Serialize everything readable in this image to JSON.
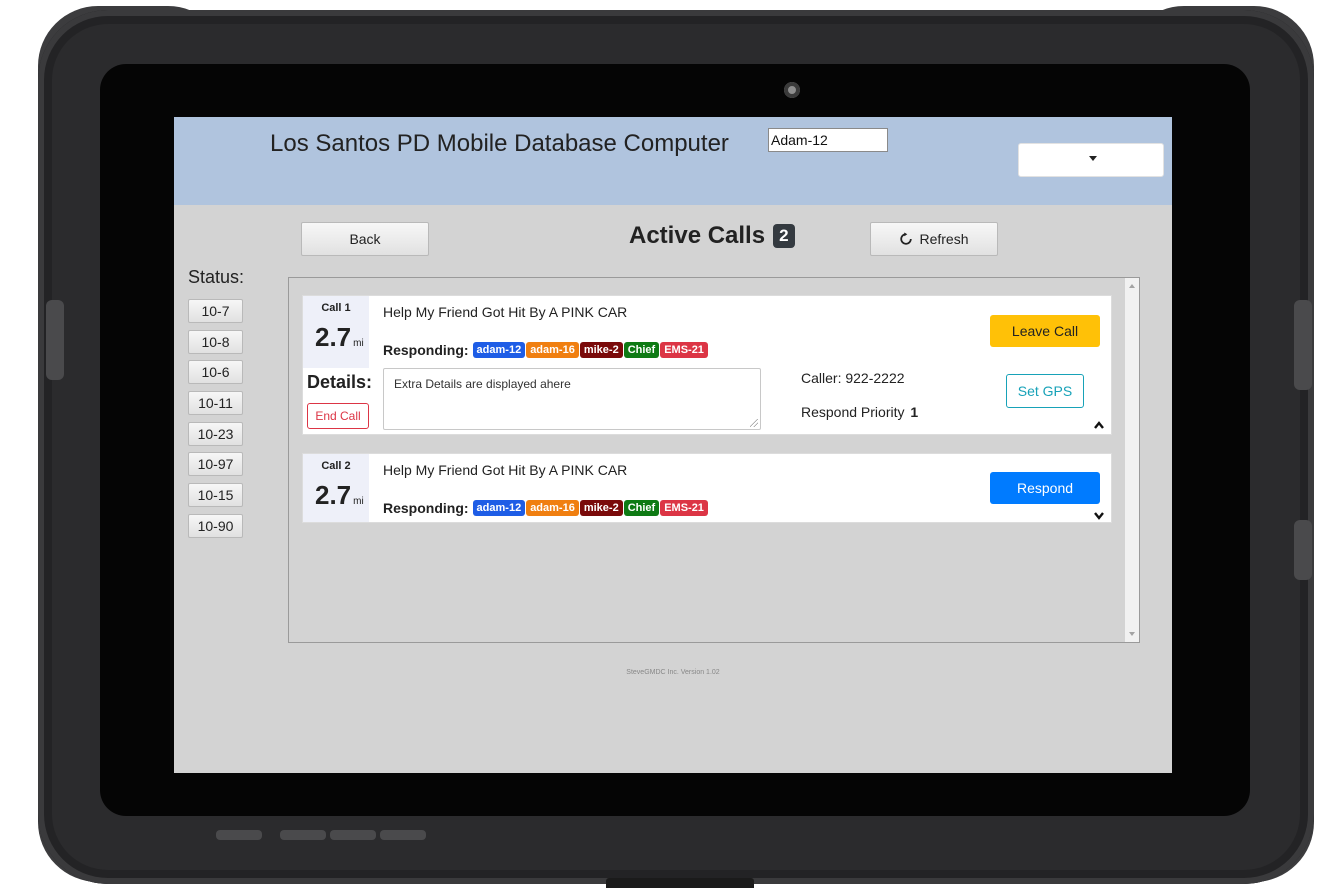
{
  "app": {
    "title": "Los Santos PD Mobile Database Computer",
    "unit_value": "Adam-12",
    "dropdown_value": ""
  },
  "toolbar": {
    "back_label": "Back",
    "active_calls_label": "Active Calls",
    "active_calls_count": "2",
    "refresh_label": "Refresh"
  },
  "status": {
    "label": "Status:",
    "codes": [
      "10-7",
      "10-8",
      "10-6",
      "10-11",
      "10-23",
      "10-97",
      "10-15",
      "10-90"
    ]
  },
  "calls": [
    {
      "call_label": "Call 1",
      "distance": "2.7",
      "distance_unit": "mi",
      "title": "Help My Friend Got Hit By A PINK CAR",
      "responding_label": "Responding:",
      "units": [
        {
          "name": "adam-12",
          "color": "#1e5de6"
        },
        {
          "name": "adam-16",
          "color": "#f07f10"
        },
        {
          "name": "mike-2",
          "color": "#7a0a0a"
        },
        {
          "name": "Chief",
          "color": "#0e7a14"
        },
        {
          "name": "EMS-21",
          "color": "#dc3545"
        }
      ],
      "details_label": "Details:",
      "details_text": "Extra Details are displayed ahere",
      "end_call_label": "End Call",
      "caller": "Caller: 922-2222",
      "priority_label": "Respond Priority",
      "priority_value": "1",
      "action_label": "Leave Call",
      "gps_label": "Set GPS"
    },
    {
      "call_label": "Call 2",
      "distance": "2.7",
      "distance_unit": "mi",
      "title": "Help My Friend Got Hit By A PINK CAR",
      "responding_label": "Responding:",
      "units": [
        {
          "name": "adam-12",
          "color": "#1e5de6"
        },
        {
          "name": "adam-16",
          "color": "#f07f10"
        },
        {
          "name": "mike-2",
          "color": "#7a0a0a"
        },
        {
          "name": "Chief",
          "color": "#0e7a14"
        },
        {
          "name": "EMS-21",
          "color": "#dc3545"
        }
      ],
      "action_label": "Respond"
    }
  ],
  "footer": {
    "version": "SteveGMDC Inc. Version 1.02"
  },
  "colors": {
    "topbar": "#b0c4de",
    "screen_bg": "#d3d3d3",
    "leave_call": "#ffc107",
    "respond": "#007bff",
    "gps_outline": "#17a2b8",
    "end_call_outline": "#dc3545"
  }
}
